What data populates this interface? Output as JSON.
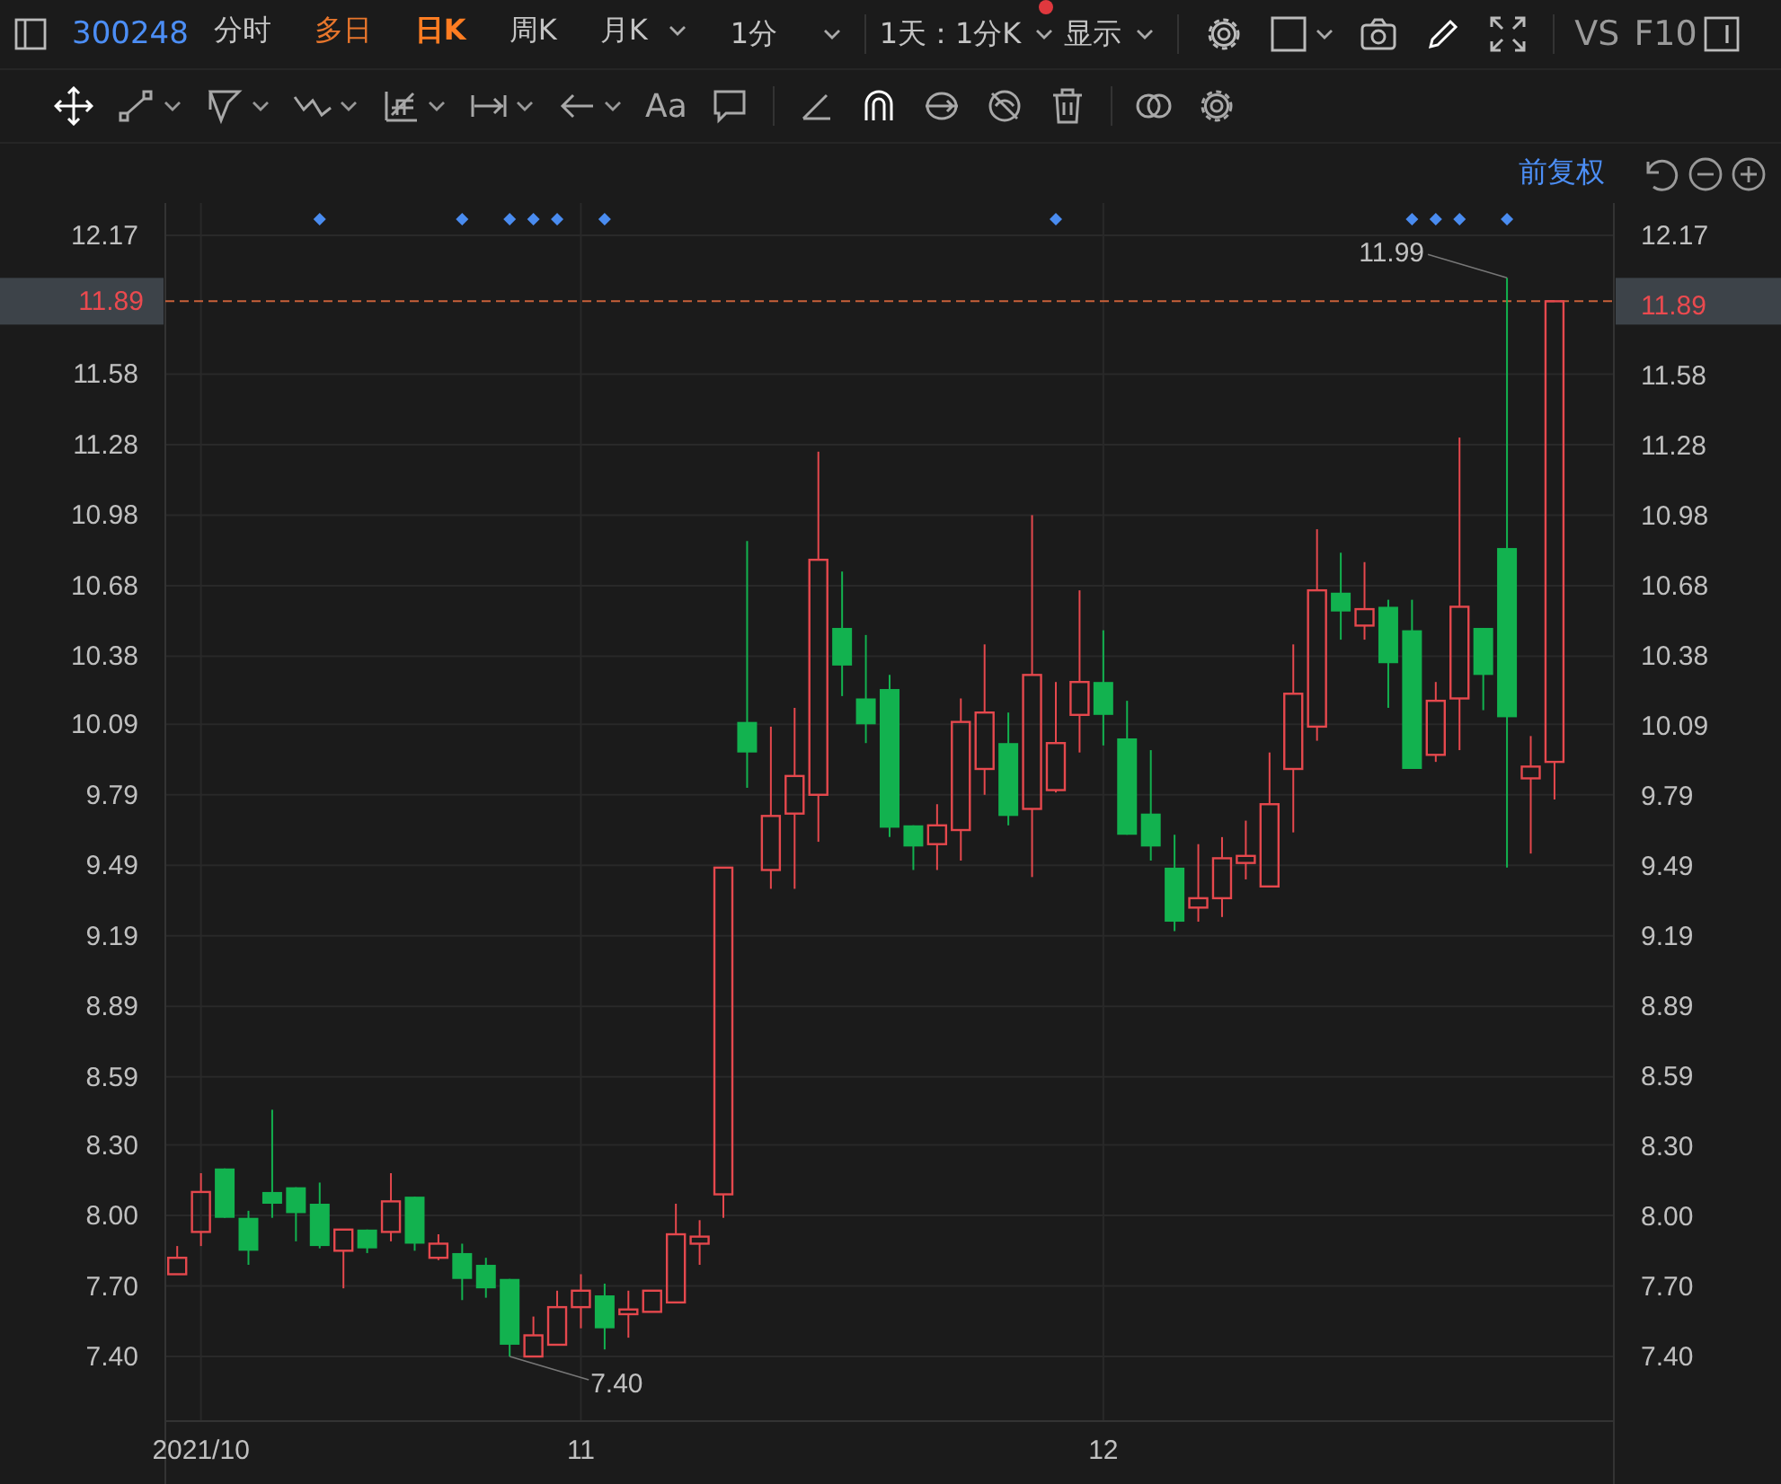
{
  "top_bar": {
    "stock_code": "300248",
    "tabs": [
      {
        "label": "分时",
        "selected": false,
        "highlighted": false,
        "dropdown": false
      },
      {
        "label": "多日",
        "selected": false,
        "highlighted": true,
        "dropdown": false
      },
      {
        "label": "日K",
        "selected": true,
        "highlighted": false,
        "dropdown": false
      },
      {
        "label": "周K",
        "selected": false,
        "highlighted": false,
        "dropdown": false
      },
      {
        "label": "月K",
        "selected": false,
        "highlighted": false,
        "dropdown": true
      }
    ],
    "interval": {
      "value": "1分",
      "dropdown": true
    },
    "range": {
      "value": "1天：1分K",
      "dropdown": true,
      "notification_dot": true
    },
    "display": {
      "label": "显示",
      "dropdown": true
    },
    "tools": [
      {
        "kind": "settings",
        "dropdown": false
      },
      {
        "kind": "layout",
        "dropdown": true
      },
      {
        "kind": "camera",
        "dropdown": false
      },
      {
        "kind": "pencil",
        "dropdown": false
      },
      {
        "kind": "fullscreen",
        "dropdown": false
      }
    ],
    "vs_label": "VS",
    "f10_label": "F10"
  },
  "drawing_tools": [
    {
      "kind": "move",
      "dropdown": false,
      "active": true
    },
    {
      "kind": "line",
      "dropdown": true,
      "active": false
    },
    {
      "kind": "polygon",
      "dropdown": true,
      "active": false
    },
    {
      "kind": "wave",
      "dropdown": true,
      "active": false
    },
    {
      "kind": "grid",
      "dropdown": true,
      "active": false
    },
    {
      "kind": "measure",
      "dropdown": true,
      "active": false
    },
    {
      "kind": "arrow",
      "dropdown": true,
      "active": false
    },
    {
      "kind": "text",
      "label": "Aa",
      "dropdown": false,
      "active": false
    },
    {
      "kind": "comment",
      "dropdown": false,
      "active": false
    },
    {
      "kind": "divider"
    },
    {
      "kind": "angle",
      "dropdown": false,
      "active": false
    },
    {
      "kind": "magnet",
      "dropdown": false,
      "active": true
    },
    {
      "kind": "link",
      "dropdown": false,
      "active": false
    },
    {
      "kind": "hide",
      "dropdown": false,
      "active": false
    },
    {
      "kind": "delete",
      "dropdown": false,
      "active": false
    },
    {
      "kind": "divider"
    },
    {
      "kind": "compare",
      "dropdown": false,
      "active": false
    },
    {
      "kind": "settings",
      "dropdown": false,
      "active": false
    }
  ],
  "chart_bar": {
    "adjust_label": "前复权",
    "controls": [
      {
        "kind": "undo"
      },
      {
        "kind": "zoom_out"
      },
      {
        "kind": "zoom_in"
      }
    ]
  },
  "chart": {
    "right_axis": {
      "labels": [
        "12.17",
        "11.89",
        "11.58",
        "11.28",
        "10.98",
        "10.68",
        "10.38",
        "10.09",
        "9.79",
        "9.49",
        "9.19",
        "8.89",
        "8.59",
        "8.30",
        "8.00",
        "7.70",
        "7.40"
      ]
    },
    "event_markers": [
      false,
      false,
      false,
      false,
      false,
      false,
      true,
      false,
      false,
      false,
      false,
      false,
      true,
      false,
      true,
      true,
      true,
      false,
      true,
      false,
      false,
      false,
      false,
      false,
      false,
      false,
      false,
      false,
      false,
      false,
      false,
      false,
      false,
      false,
      false,
      false,
      false,
      true,
      false,
      false,
      false,
      false,
      false,
      false,
      false,
      false,
      false,
      false,
      false,
      false,
      false,
      false,
      true,
      true,
      true,
      false,
      true,
      false,
      false
    ],
    "chart_data": {
      "type": "candlestick",
      "grid": true,
      "ylim": [
        7.125,
        12.308
      ],
      "categories": [
        null,
        "2021/10",
        null,
        null,
        null,
        null,
        null,
        null,
        null,
        null,
        null,
        null,
        null,
        null,
        null,
        null,
        null,
        "11",
        null,
        null,
        null,
        null,
        null,
        null,
        null,
        null,
        null,
        null,
        null,
        null,
        null,
        null,
        null,
        null,
        null,
        null,
        null,
        null,
        null,
        "12",
        null,
        null,
        null,
        null,
        null,
        null,
        null,
        null,
        null,
        null,
        null,
        null,
        null,
        null,
        null,
        null,
        null,
        null,
        null,
        null,
        null
      ],
      "yticks": [
        {
          "value": 12.17,
          "label": "12.17"
        },
        {
          "value": 11.58,
          "label": "11.58"
        },
        {
          "value": 11.28,
          "label": "11.28"
        },
        {
          "value": 10.98,
          "label": "10.98"
        },
        {
          "value": 10.68,
          "label": "10.68"
        },
        {
          "value": 10.38,
          "label": "10.38"
        },
        {
          "value": 10.09,
          "label": "10.09"
        },
        {
          "value": 9.79,
          "label": "9.79"
        },
        {
          "value": 9.49,
          "label": "9.49"
        },
        {
          "value": 9.19,
          "label": "9.19"
        },
        {
          "value": 8.89,
          "label": "8.89"
        },
        {
          "value": 8.59,
          "label": "8.59"
        },
        {
          "value": 8.3,
          "label": "8.30"
        },
        {
          "value": 8.0,
          "label": "8.00"
        },
        {
          "value": 7.7,
          "label": "7.70"
        },
        {
          "value": 7.4,
          "label": "7.40"
        }
      ],
      "ohlc": [
        [
          7.75,
          7.87,
          7.75,
          7.82
        ],
        [
          7.93,
          8.18,
          7.87,
          8.1
        ],
        [
          8.2,
          8.2,
          7.99,
          7.99
        ],
        [
          7.99,
          8.02,
          7.79,
          7.85
        ],
        [
          8.1,
          8.45,
          7.99,
          8.05
        ],
        [
          8.12,
          8.12,
          7.89,
          8.01
        ],
        [
          8.05,
          8.14,
          7.86,
          7.87
        ],
        [
          7.85,
          7.94,
          7.69,
          7.94
        ],
        [
          7.94,
          7.94,
          7.84,
          7.86
        ],
        [
          7.93,
          8.18,
          7.89,
          8.06
        ],
        [
          8.08,
          8.08,
          7.85,
          7.88
        ],
        [
          7.82,
          7.92,
          7.81,
          7.88
        ],
        [
          7.84,
          7.88,
          7.64,
          7.73
        ],
        [
          7.79,
          7.82,
          7.65,
          7.69
        ],
        [
          7.73,
          7.73,
          7.4,
          7.45
        ],
        [
          7.4,
          7.57,
          7.4,
          7.49
        ],
        [
          7.45,
          7.68,
          7.45,
          7.61
        ],
        [
          7.61,
          7.75,
          7.52,
          7.68
        ],
        [
          7.66,
          7.71,
          7.43,
          7.52
        ],
        [
          7.58,
          7.68,
          7.48,
          7.6
        ],
        [
          7.59,
          7.68,
          7.59,
          7.68
        ],
        [
          7.63,
          8.05,
          7.63,
          7.92
        ],
        [
          7.88,
          7.98,
          7.79,
          7.91
        ],
        [
          8.09,
          9.48,
          7.99,
          9.48
        ],
        [
          10.1,
          10.87,
          9.82,
          9.97
        ],
        [
          9.47,
          10.08,
          9.39,
          9.7
        ],
        [
          9.71,
          10.16,
          9.39,
          9.87
        ],
        [
          9.79,
          11.25,
          9.59,
          10.79
        ],
        [
          10.5,
          10.74,
          10.21,
          10.34
        ],
        [
          10.2,
          10.47,
          10.01,
          10.09
        ],
        [
          10.24,
          10.3,
          9.61,
          9.65
        ],
        [
          9.66,
          9.66,
          9.47,
          9.57
        ],
        [
          9.58,
          9.75,
          9.47,
          9.66
        ],
        [
          9.64,
          10.2,
          9.51,
          10.1
        ],
        [
          9.9,
          10.43,
          9.79,
          10.14
        ],
        [
          10.01,
          10.14,
          9.66,
          9.7
        ],
        [
          9.73,
          10.98,
          9.44,
          10.3
        ],
        [
          9.81,
          10.27,
          9.8,
          10.01
        ],
        [
          10.13,
          10.66,
          9.97,
          10.27
        ],
        [
          10.27,
          10.49,
          10.0,
          10.13
        ],
        [
          10.03,
          10.19,
          9.62,
          9.62
        ],
        [
          9.71,
          9.98,
          9.51,
          9.57
        ],
        [
          9.48,
          9.62,
          9.21,
          9.25
        ],
        [
          9.31,
          9.58,
          9.25,
          9.35
        ],
        [
          9.35,
          9.61,
          9.27,
          9.52
        ],
        [
          9.5,
          9.68,
          9.43,
          9.53
        ],
        [
          9.4,
          9.97,
          9.4,
          9.75
        ],
        [
          9.9,
          10.43,
          9.63,
          10.22
        ],
        [
          10.08,
          10.92,
          10.02,
          10.66
        ],
        [
          10.65,
          10.82,
          10.45,
          10.57
        ],
        [
          10.51,
          10.78,
          10.45,
          10.58
        ],
        [
          10.59,
          10.62,
          10.16,
          10.35
        ],
        [
          10.49,
          10.62,
          9.9,
          9.9
        ],
        [
          9.96,
          10.27,
          9.93,
          10.19
        ],
        [
          10.2,
          11.31,
          9.98,
          10.59
        ],
        [
          10.5,
          10.5,
          10.15,
          10.3
        ],
        [
          10.84,
          11.99,
          9.48,
          10.12
        ],
        [
          9.86,
          10.04,
          9.54,
          9.91
        ],
        [
          9.93,
          11.89,
          9.77,
          11.89
        ],
        null,
        null
      ],
      "ref_lines": [
        {
          "axis": "y",
          "value": 11.89,
          "label": "11.89"
        }
      ],
      "annotations": [
        "11.99",
        "7.40"
      ]
    }
  }
}
